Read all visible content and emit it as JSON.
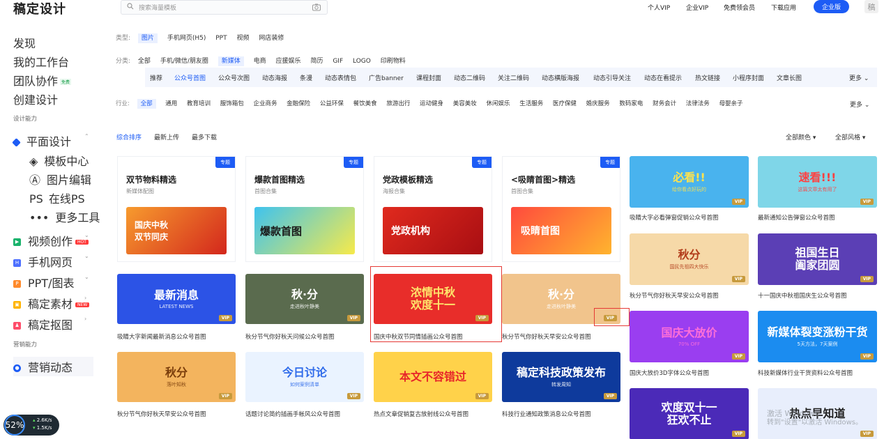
{
  "header": {
    "logo": "稿定设计",
    "search_placeholder": "搜索海量模板",
    "nav": [
      "个人VIP",
      "企业VIP",
      "免费领会员",
      "下载应用"
    ],
    "pro_button": "企业版",
    "avatar": "稿"
  },
  "sidebar": {
    "top_items": [
      "发现",
      "我的工作台",
      "团队协作",
      "创建设计"
    ],
    "team_badge": "免费",
    "group1": "设计能力",
    "design": "平面设计",
    "design_sub": [
      "模板中心",
      "图片编辑",
      "在线PS",
      "更多工具"
    ],
    "design_sub_icons": [
      "layers-icon",
      "compass-icon",
      "ps-text-icon",
      "dots-icon"
    ],
    "ps_icon_text": "PS",
    "sections": [
      {
        "label": "视频创作",
        "badge": "HOT",
        "color": "#19b26b"
      },
      {
        "label": "手机网页",
        "badge": "",
        "color": "#4c6fff"
      },
      {
        "label": "PPT/图表",
        "badge": "",
        "color": "#ff8a2b"
      },
      {
        "label": "稿定素材",
        "badge": "NEW",
        "color": "#ffb300"
      },
      {
        "label": "稿定抠图",
        "badge": "",
        "color": "#ff4d6a"
      }
    ],
    "group2": "营销能力",
    "marketing": "营销动态"
  },
  "filters": {
    "type_label": "类型:",
    "types": [
      "图片",
      "手机网页(H5)",
      "PPT",
      "视频",
      "网店装修"
    ],
    "cat_label": "分类:",
    "cats": [
      "全部",
      "手机/微信/朋友圈",
      "新媒体",
      "电商",
      "应援娱乐",
      "简历",
      "GIF",
      "LOGO",
      "印刷物料"
    ],
    "subs": [
      "推荐",
      "公众号首图",
      "公众号次图",
      "动态海报",
      "条漫",
      "动态表情包",
      "广告banner",
      "课程封面",
      "动态二维码",
      "关注二维码",
      "动态横版海报",
      "动态引导关注",
      "动态在看提示",
      "热文链接",
      "小程序封面",
      "文章长图"
    ],
    "more": "更多",
    "ind_label": "行业:",
    "industries": [
      "全部",
      "通用",
      "教育培训",
      "服饰箱包",
      "企业商务",
      "金融保险",
      "公益环保",
      "餐饮美食",
      "旅游出行",
      "运动健身",
      "美容美妆",
      "休闲娱乐",
      "生活服务",
      "医疗保健",
      "婚庆服务",
      "数码家电",
      "财务会计",
      "法律法务",
      "母婴亲子"
    ]
  },
  "sort": {
    "tabs": [
      "综合排序",
      "最新上传",
      "最多下载"
    ],
    "color": "全部颜色",
    "style": "全部风格"
  },
  "topic_badge": "专题",
  "vip": "VIP",
  "topic_cards": [
    {
      "title": "双节物料精选",
      "sub": "新媒体配图",
      "img": "国庆中秋\n双节同庆",
      "bg": "#e44a2a"
    },
    {
      "title": "爆款首图精选",
      "sub": "首图合集",
      "img": "爆款首图",
      "bg": "#2aa6d8"
    },
    {
      "title": "党政模板精选",
      "sub": "海报合集",
      "img": "党政机构",
      "bg": "#c9151b"
    },
    {
      "title": "<吸睛首图>精选",
      "sub": "首图合集",
      "img": "吸睛首图",
      "bg": "#ff5a4d"
    }
  ],
  "templates": [
    {
      "img": "必看!!",
      "sub": "给你看点好玩的",
      "cap": "吸睛大字必看弹窗促销公众号首图",
      "bg": "#49b3ee",
      "fg": "#ffe34d"
    },
    {
      "img": "速看!!!",
      "sub": "这篇文章太有用了",
      "cap": "最新通知公告弹窗公众号首图",
      "bg": "#7fd6e8",
      "fg": "#ff4141"
    },
    {
      "img": "秋分",
      "sub": "国民先祖四大快乐",
      "cap": "秋分节气你好秋天早安公众号首图",
      "bg": "#f6d9a8",
      "fg": "#b23c1a"
    },
    {
      "img": "祖国生日\n阖家团圆",
      "sub": "",
      "cap": "十一国庆中秋祖国庆生公众号首图",
      "bg": "#5b3fb5",
      "fg": "#fff"
    },
    {
      "img": "最新消息",
      "sub": "LATEST NEWS",
      "cap": "吸睛大字新闻最新消息公众号首图",
      "bg": "#2c53e6",
      "fg": "#fff"
    },
    {
      "img": "秋·分",
      "sub": "走进秋叶静美",
      "cap": "秋分节气你好秋天问候公众号首图",
      "bg": "#5a6b4e",
      "fg": "#fff"
    },
    {
      "img": "浓情中秋\n欢度十一",
      "sub": "",
      "cap": "国庆中秋双节同情插画公众号首图",
      "bg": "#e82d2a",
      "fg": "#ffe56b"
    },
    {
      "img": "秋·分",
      "sub": "走进秋叶静美",
      "cap": "秋分节气你好秋天早安公众号首图",
      "bg": "#f1c48c",
      "fg": "#fff"
    },
    {
      "img": "国庆大放价",
      "sub": "70% OFF",
      "cap": "国庆大放价3D字体公众号首图",
      "bg": "#9a3ef0",
      "fg": "#ff6fd8"
    },
    {
      "img": "新媒体裂变涨粉干货",
      "sub": "5天方法，7天案例",
      "cap": "科技新媒体行业干货资料公众号首图",
      "bg": "#1b8cf0",
      "fg": "#fff"
    },
    {
      "img": "秋分",
      "sub": "落叶知秋",
      "cap": "秋分节气你好秋天早安公众号首图",
      "bg": "#f3b45e",
      "fg": "#7a3d0b"
    },
    {
      "img": "今日讨论",
      "sub": "如何案例清单",
      "cap": "话题讨论简约插画手帐风公众号首图",
      "bg": "#eaf3ff",
      "fg": "#2f6bea"
    },
    {
      "img": "本文不容错过",
      "sub": "",
      "cap": "热点文章促销复古放射线公众号首图",
      "bg": "#ffd24a",
      "fg": "#e7262a"
    },
    {
      "img": "稿定科技政策发布",
      "sub": "转发周知",
      "cap": "科技行业通知政策消息公众号首图",
      "bg": "#0e3a9c",
      "fg": "#fff"
    },
    {
      "img": "欢度双十一\n狂欢不止",
      "sub": "",
      "cap": "",
      "bg": "#4b2ab8",
      "fg": "#fff"
    },
    {
      "img": "热点早知道",
      "sub": "",
      "cap": "",
      "bg": "#e8eefc",
      "fg": "#222"
    }
  ],
  "speed": {
    "pct": "52%",
    "up": "2.6K/s",
    "down": "1.5K/s"
  },
  "watermark": {
    "line1": "激活 Windows",
    "line2": "转到\"设置\"以激活 Windows。"
  }
}
